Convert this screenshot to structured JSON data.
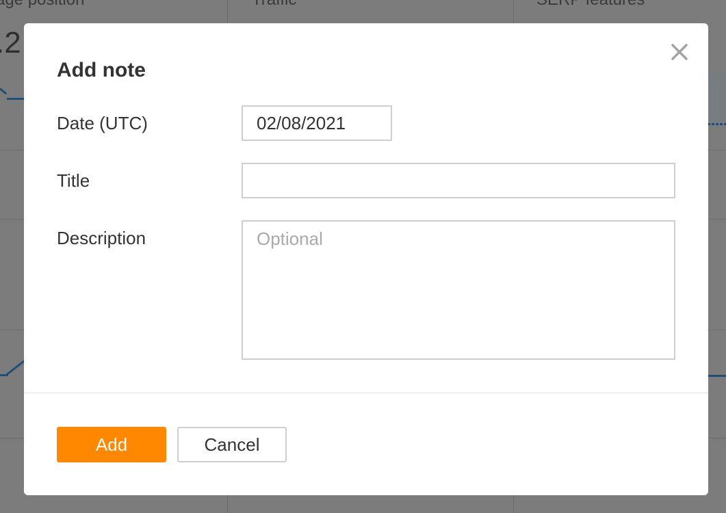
{
  "background": {
    "columns": [
      {
        "label": "age position"
      },
      {
        "label": "Traffic"
      },
      {
        "label": "SERP features"
      }
    ],
    "big_value": ".2"
  },
  "modal": {
    "title": "Add note",
    "fields": {
      "date": {
        "label": "Date (UTC)",
        "value": "02/08/2021"
      },
      "title": {
        "label": "Title",
        "value": "",
        "placeholder": ""
      },
      "description": {
        "label": "Description",
        "value": "",
        "placeholder": "Optional"
      }
    },
    "buttons": {
      "add": "Add",
      "cancel": "Cancel"
    },
    "close_icon": "close-icon"
  },
  "colors": {
    "primary": "#ff8800",
    "overlay": "#7c7c7c",
    "text": "#333333",
    "border": "#cfcfcf",
    "placeholder": "#aaaaaa"
  }
}
